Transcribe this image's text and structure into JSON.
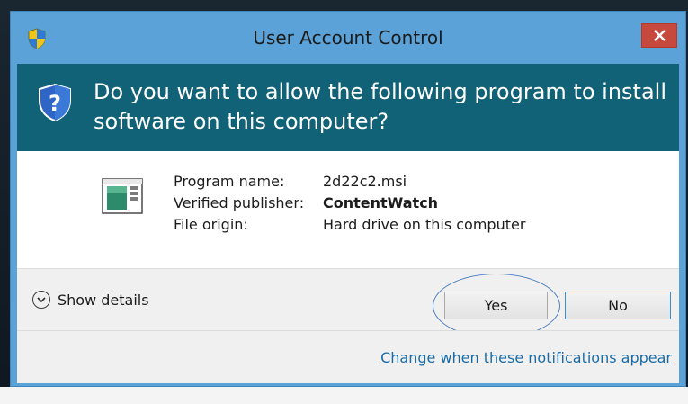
{
  "window": {
    "title": "User Account Control",
    "close_icon": "close-icon",
    "title_icon": "uac-shield-icon"
  },
  "header": {
    "line1": "Do you want to allow the following program to install",
    "line2": "software on this computer?",
    "icon": "question-shield-icon"
  },
  "details": {
    "icon": "program-icon",
    "program_name_label": "Program name:",
    "program_name_value": "2d22c2.msi",
    "publisher_label": "Verified publisher:",
    "publisher_value": "ContentWatch",
    "origin_label": "File origin:",
    "origin_value": "Hard drive on this computer"
  },
  "footer": {
    "show_details_label": "Show details",
    "show_details_icon": "chevron-down-icon",
    "yes_label": "Yes",
    "no_label": "No"
  },
  "bottom": {
    "link_text": "Change when these notifications appear"
  },
  "colors": {
    "titlebar": "#5aa2d8",
    "header": "#116277",
    "close": "#c7483d",
    "link": "#1a6ca8",
    "highlight_ellipse": "#4a7fc0"
  }
}
